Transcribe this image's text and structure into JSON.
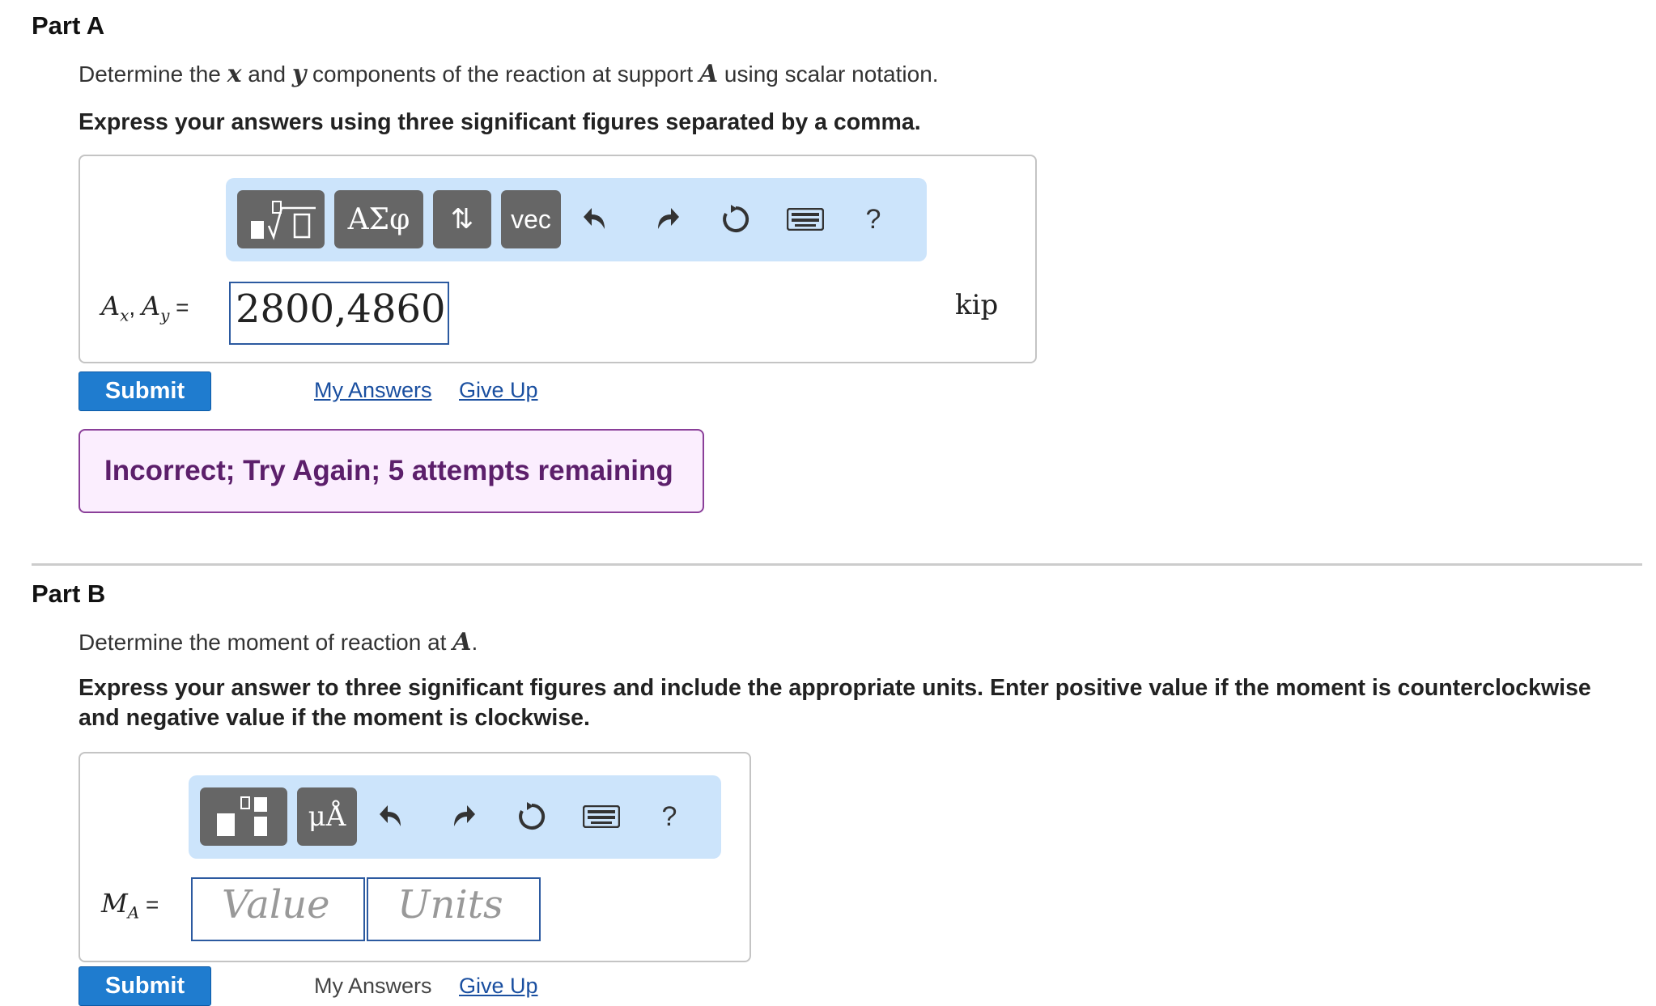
{
  "part_a": {
    "title": "Part A",
    "prompt_pre": "Determine the ",
    "var_x": "x",
    "prompt_and": " and ",
    "var_y": "y",
    "prompt_mid": " components of the reaction at support ",
    "var_A": "A",
    "prompt_post": " using scalar notation.",
    "instruction": "Express your answers using three significant figures separated by a comma.",
    "toolbar": {
      "templates_icon": "fraction-root-template-icon",
      "greek_label": "ΑΣφ",
      "arrows_label": "⇅",
      "vec_label": "vec",
      "undo_icon": "undo-icon",
      "redo_icon": "redo-icon",
      "reset_icon": "reset-icon",
      "keyboard_icon": "keyboard-icon",
      "help_label": "?"
    },
    "label_main1": "A",
    "label_sub1": "x",
    "label_sep": ", ",
    "label_main2": "A",
    "label_sub2": "y",
    "label_eq": " =",
    "input_value": "2800,4860",
    "unit": "kip",
    "submit_label": "Submit",
    "my_answers_label": "My Answers",
    "give_up_label": "Give Up",
    "feedback": "Incorrect; Try Again; 5 attempts remaining"
  },
  "part_b": {
    "title": "Part B",
    "prompt_pre": "Determine the moment of reaction at ",
    "var_A": "A",
    "prompt_post": ".",
    "instruction_line1": "Express your answer to three significant figures and include the appropriate units. Enter positive value if the moment is counterclockwise",
    "instruction_line2": "and negative value if the moment is clockwise.",
    "toolbar": {
      "templates_icon": "value-units-template-icon",
      "units_label": "μÅ",
      "undo_icon": "undo-icon",
      "redo_icon": "redo-icon",
      "reset_icon": "reset-icon",
      "keyboard_icon": "keyboard-icon",
      "help_label": "?"
    },
    "label_main": "M",
    "label_sub": "A",
    "label_eq": " =",
    "value_placeholder": "Value",
    "units_placeholder": "Units",
    "submit_label": "Submit",
    "my_answers_label": "My Answers",
    "give_up_label": "Give Up"
  },
  "colors": {
    "submit": "#1f7ccf",
    "toolbar_bg": "#cce4fb",
    "feedback_bg": "#fbeefe",
    "feedback_border": "#8a3f99",
    "link": "#1a4fa0"
  }
}
